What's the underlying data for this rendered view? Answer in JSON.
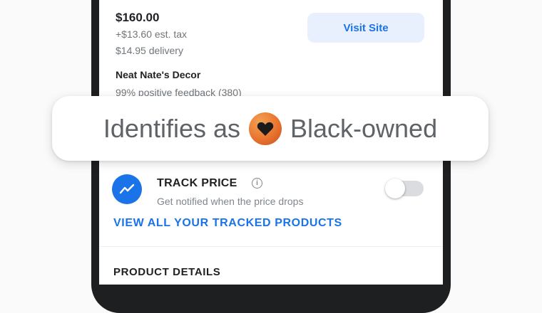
{
  "listing": {
    "price": "$160.00",
    "tax": "+$13.60 est. tax",
    "delivery": "$14.95 delivery",
    "seller": "Neat Nate's Decor",
    "feedback": "99% positive feedback (380)",
    "visit_label": "Visit Site"
  },
  "badge": {
    "prefix": "Identifies as",
    "suffix": "Black-owned",
    "icon": "heart-icon",
    "color": "#e8742f"
  },
  "track": {
    "title": "TRACK PRICE",
    "subtitle": "Get notified when the price drops",
    "toggle_on": false,
    "view_all_label": "VIEW ALL YOUR TRACKED PRODUCTS"
  },
  "details": {
    "title": "PRODUCT DETAILS"
  },
  "colors": {
    "accent": "#1a73e8",
    "accent_bg": "#e8f0fe",
    "text_primary": "#202124",
    "text_secondary": "#70757a"
  }
}
